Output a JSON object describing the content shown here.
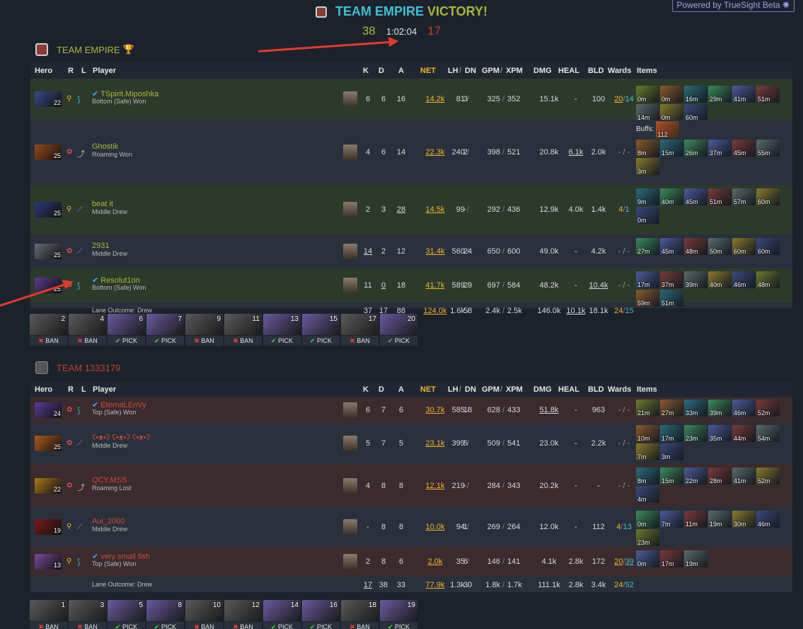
{
  "header": {
    "team": "TEAM EMPIRE",
    "victory": "VICTORY!",
    "score_radiant": "38",
    "duration": "1:02:04",
    "score_dire": "17",
    "powered": "Powered by TrueSight Beta"
  },
  "columns": {
    "hero": "Hero",
    "r": "R",
    "l": "L",
    "player": "Player",
    "k": "K",
    "d": "D",
    "a": "A",
    "net": "NET",
    "lh": "LH",
    "slash": "/",
    "dn": "DN",
    "gpm": "GPM",
    "xpm": "XPM",
    "dmg": "DMG",
    "heal": "HEAL",
    "bld": "BLD",
    "wards": "Wards",
    "items": "Items"
  },
  "radiant": {
    "name": "TEAM EMPIRE",
    "players": [
      {
        "lvl": "22",
        "name": "TSpirit.Miposhka",
        "lane": "Bottom (Safe) Won",
        "k": "6",
        "d": "6",
        "a": "16",
        "net": "14.2k",
        "lh": "81",
        "dn": "3",
        "gpm": "325",
        "xpm": "352",
        "dmg": "15.1k",
        "heal": "-",
        "bld": "100",
        "wo": "20",
        "ws": "14",
        "items": [
          "0m",
          "0m",
          "16m",
          "29m",
          "41m",
          "51m",
          "14m",
          "0m",
          "60m"
        ]
      },
      {
        "lvl": "25",
        "name": "Ghostik",
        "lane": "Roaming Won",
        "k": "4",
        "d": "6",
        "a": "14",
        "net": "22.3k",
        "lh": "240",
        "dn": "2",
        "gpm": "398",
        "xpm": "521",
        "dmg": "20.8k",
        "heal": "6.1k",
        "bld": "2.0k",
        "wards": "- / -",
        "buffs_label": "Buffs:",
        "buff": "112",
        "items": [
          "8m",
          "15m",
          "26m",
          "37m",
          "45m",
          "55m",
          "3m"
        ]
      },
      {
        "lvl": "25",
        "name": "beat it",
        "lane": "Middle Drew",
        "k": "2",
        "d": "3",
        "a": "28",
        "net": "14.5k",
        "lh": "99",
        "dn": "-",
        "gpm": "292",
        "xpm": "436",
        "dmg": "12.9k",
        "heal": "4.0k",
        "bld": "1.4k",
        "wo": "4",
        "ws": "1",
        "items": [
          "9m",
          "40m",
          "45m",
          "51m",
          "57m",
          "60m",
          "0m"
        ]
      },
      {
        "lvl": "25",
        "name": "2931",
        "lane": "Middle Drew",
        "k": "14",
        "d": "2",
        "a": "12",
        "net": "31.4k",
        "lh": "560",
        "dn": "24",
        "gpm": "650",
        "xpm": "600",
        "dmg": "49.0k",
        "heal": "-",
        "bld": "4.2k",
        "wards": "- / -",
        "items": [
          "27m",
          "45m",
          "48m",
          "50m",
          "60m",
          "60m"
        ]
      },
      {
        "lvl": "25",
        "name": "Resolut1on",
        "lane": "Bottom (Safe) Won",
        "k": "11",
        "d": "0",
        "a": "18",
        "net": "41.7k",
        "lh": "589",
        "dn": "29",
        "gpm": "697",
        "xpm": "584",
        "dmg": "48.2k",
        "heal": "-",
        "bld": "10.4k",
        "wards": "- / -",
        "items": [
          "17m",
          "37m",
          "39m",
          "40m",
          "46m",
          "48m",
          "59m",
          "51m"
        ]
      }
    ],
    "totals": {
      "lane": "Lane Outcome: Drew",
      "k": "37",
      "d": "17",
      "a": "88",
      "net": "124.0k",
      "lh": "1.6k",
      "dn": "58",
      "gpm": "2.4k",
      "xpm": "2.5k",
      "dmg": "146.0k",
      "heal": "10.1k",
      "bld": "18.1k",
      "wo": "24",
      "ws": "15"
    },
    "draft": [
      {
        "n": "2",
        "t": "BAN"
      },
      {
        "n": "4",
        "t": "BAN"
      },
      {
        "n": "6",
        "t": "PICK"
      },
      {
        "n": "7",
        "t": "PICK"
      },
      {
        "n": "9",
        "t": "BAN"
      },
      {
        "n": "11",
        "t": "BAN"
      },
      {
        "n": "13",
        "t": "PICK"
      },
      {
        "n": "15",
        "t": "PICK"
      },
      {
        "n": "17",
        "t": "BAN"
      },
      {
        "n": "20",
        "t": "PICK"
      }
    ]
  },
  "dire": {
    "name": "TEAM 1333179",
    "players": [
      {
        "lvl": "24",
        "name": "EternaLEnVy",
        "lane": "Top (Safe) Won",
        "k": "6",
        "d": "7",
        "a": "6",
        "net": "30.7k",
        "lh": "585",
        "dn": "18",
        "gpm": "628",
        "xpm": "433",
        "dmg": "51.8k",
        "heal": "-",
        "bld": "963",
        "wards": "- / -",
        "items": [
          "21m",
          "27m",
          "33m",
          "39m",
          "46m",
          "52m"
        ]
      },
      {
        "lvl": "25",
        "name": "ʕ•ᴥ•ʔ ʕ•ᴥ•ʔ ʕ•ᴥ•ʔ",
        "lane": "Middle Drew",
        "k": "5",
        "d": "7",
        "a": "5",
        "net": "23.1k",
        "lh": "399",
        "dn": "5",
        "gpm": "509",
        "xpm": "541",
        "dmg": "23.0k",
        "heal": "-",
        "bld": "2.2k",
        "wards": "- / -",
        "items": [
          "10m",
          "17m",
          "23m",
          "35m",
          "44m",
          "54m",
          "7m",
          "3m"
        ]
      },
      {
        "lvl": "22",
        "name": "QCY.MSS",
        "lane": "Roaming Lost",
        "k": "4",
        "d": "8",
        "a": "8",
        "net": "12.1k",
        "lh": "219",
        "dn": "-",
        "gpm": "284",
        "xpm": "343",
        "dmg": "20.2k",
        "heal": "-",
        "bld": "-",
        "wards": "- / -",
        "items": [
          "8m",
          "15m",
          "22m",
          "28m",
          "41m",
          "52m",
          "4m"
        ]
      },
      {
        "lvl": "19",
        "name": "Aui_2000",
        "lane": "Middle Drew",
        "k": "-",
        "d": "8",
        "a": "8",
        "net": "10.0k",
        "lh": "94",
        "dn": "1",
        "gpm": "269",
        "xpm": "264",
        "dmg": "12.0k",
        "heal": "-",
        "bld": "112",
        "wo": "4",
        "ws": "13",
        "items": [
          "0m",
          "7m",
          "11m",
          "19m",
          "30m",
          "46m",
          "23m"
        ]
      },
      {
        "lvl": "13",
        "name": "very small fish",
        "lane": "Top (Safe) Won",
        "k": "2",
        "d": "8",
        "a": "6",
        "net": "2.0k",
        "lh": "35",
        "dn": "6",
        "gpm": "146",
        "xpm": "141",
        "dmg": "4.1k",
        "heal": "2.8k",
        "bld": "172",
        "wo": "20",
        "ws": "39",
        "items": [
          "0m",
          "17m",
          "19m"
        ]
      }
    ],
    "totals": {
      "lane": "Lane Outcome: Drew",
      "k": "17",
      "d": "38",
      "a": "33",
      "net": "77.9k",
      "lh": "1.3k",
      "dn": "30",
      "gpm": "1.8k",
      "xpm": "1.7k",
      "dmg": "111.1k",
      "heal": "2.8k",
      "bld": "3.4k",
      "wo": "24",
      "ws": "52"
    },
    "draft": [
      {
        "n": "1",
        "t": "BAN"
      },
      {
        "n": "3",
        "t": "BAN"
      },
      {
        "n": "5",
        "t": "PICK"
      },
      {
        "n": "8",
        "t": "PICK"
      },
      {
        "n": "10",
        "t": "BAN"
      },
      {
        "n": "12",
        "t": "BAN"
      },
      {
        "n": "14",
        "t": "PICK"
      },
      {
        "n": "16",
        "t": "PICK"
      },
      {
        "n": "18",
        "t": "BAN"
      },
      {
        "n": "19",
        "t": "PICK"
      }
    ]
  },
  "colors": {
    "radiant": "#a8b73a",
    "dire": "#c23c2a",
    "accent": "#41bfd1",
    "net": "#f0b429",
    "arrow": "#e23a2e"
  }
}
